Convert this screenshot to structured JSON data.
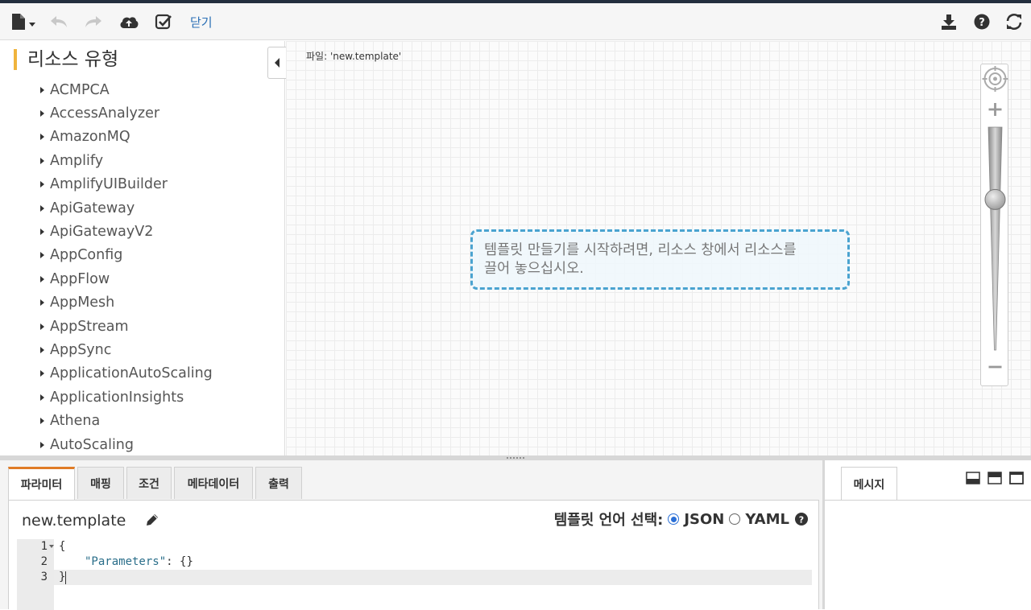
{
  "toolbar": {
    "close_label": "닫기",
    "icons": [
      "file-icon",
      "undo-icon",
      "redo-icon",
      "cloud-upload-icon",
      "validate-icon",
      "download-icon",
      "help-icon",
      "refresh-icon"
    ]
  },
  "resources_panel": {
    "title": "리소스 유형",
    "items": [
      {
        "label": "ACMPCA"
      },
      {
        "label": "AccessAnalyzer"
      },
      {
        "label": "AmazonMQ"
      },
      {
        "label": "Amplify"
      },
      {
        "label": "AmplifyUIBuilder"
      },
      {
        "label": "ApiGateway"
      },
      {
        "label": "ApiGatewayV2"
      },
      {
        "label": "AppConfig"
      },
      {
        "label": "AppFlow"
      },
      {
        "label": "AppMesh"
      },
      {
        "label": "AppStream"
      },
      {
        "label": "AppSync"
      },
      {
        "label": "ApplicationAutoScaling"
      },
      {
        "label": "ApplicationInsights"
      },
      {
        "label": "Athena"
      },
      {
        "label": "AutoScaling"
      }
    ]
  },
  "canvas": {
    "file_label": "파일: 'new.template'",
    "hint_line1": "템플릿 만들기를 시작하려면, 리소스 창에서 리소스를",
    "hint_line2": "끌어 놓으십시오.",
    "zoom_plus": "+",
    "zoom_minus": "−",
    "zoom_level": 0.7
  },
  "bottom_tabs": [
    {
      "label": "파라미터",
      "active": true
    },
    {
      "label": "매핑"
    },
    {
      "label": "조건"
    },
    {
      "label": "메타데이터"
    },
    {
      "label": "출력"
    }
  ],
  "editor": {
    "template_name": "new.template",
    "language_label": "템플릿 언어 선택:",
    "options": [
      "JSON",
      "YAML"
    ],
    "selected": "JSON",
    "lines": [
      {
        "num": "1",
        "text": "{"
      },
      {
        "num": "2",
        "key": "\"Parameters\"",
        "rest": ": {}"
      },
      {
        "num": "3",
        "text": "}"
      }
    ]
  },
  "messages": {
    "tab_label": "메시지"
  },
  "colors": {
    "accent_orange": "#e07b26",
    "title_bar": "#f0b43c",
    "hint_border": "#4aa3d0",
    "link_blue": "#2a6fb5",
    "json_string": "#2a6e8a"
  }
}
